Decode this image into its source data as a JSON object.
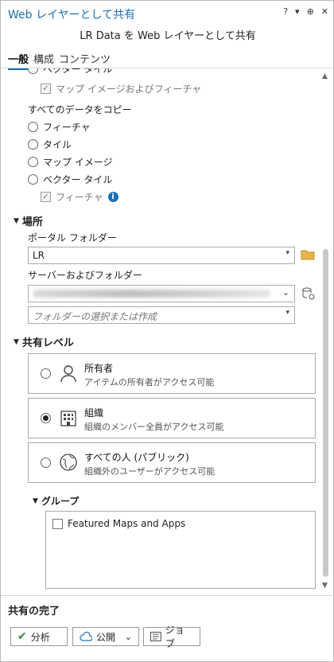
{
  "window": {
    "title": "Web レイヤーとして共有",
    "controls": [
      "?",
      "▾",
      "⊕",
      "✕"
    ]
  },
  "subtitle": "LR Data を Web レイヤーとして共有",
  "tabs": [
    {
      "label": "一般",
      "active": true
    },
    {
      "label": "構成",
      "active": false
    },
    {
      "label": "コンテンツ",
      "active": false
    }
  ],
  "data_options": {
    "partial_top": "ベクター タイル",
    "map_image_and_feature": "マップ イメージおよびフィーチャ",
    "copy_all_heading": "すべてのデータをコピー",
    "radio_feature": "フィーチャ",
    "radio_tile": "タイル",
    "radio_map_image": "マップ イメージ",
    "radio_vector_tile": "ベクター タイル",
    "feature_check": "フィーチャ"
  },
  "location": {
    "heading": "場所",
    "portal_folder_label": "ポータル フォルダー",
    "portal_folder_value": "LR",
    "server_folder_label": "サーバーおよびフォルダー",
    "folder_placeholder": "フォルダーの選択または作成"
  },
  "sharing": {
    "heading": "共有レベル",
    "options": [
      {
        "title": "所有者",
        "desc": "アイテムの所有者がアクセス可能",
        "selected": false,
        "icon": "person-icon"
      },
      {
        "title": "組織",
        "desc": "組織のメンバー全員がアクセス可能",
        "selected": true,
        "icon": "building-icon"
      },
      {
        "title": "すべての人 (パブリック)",
        "desc": "組織外のユーザーがアクセス可能",
        "selected": false,
        "icon": "globe-icon"
      }
    ]
  },
  "group": {
    "heading": "グループ",
    "items": [
      "Featured Maps and Apps"
    ]
  },
  "footer": {
    "heading": "共有の完了",
    "analyze_label": "分析",
    "publish_label": "公開",
    "jobs_label": "ジョブ"
  },
  "colors": {
    "accent": "#1a6fb5",
    "check_green": "#2e8b3a"
  }
}
